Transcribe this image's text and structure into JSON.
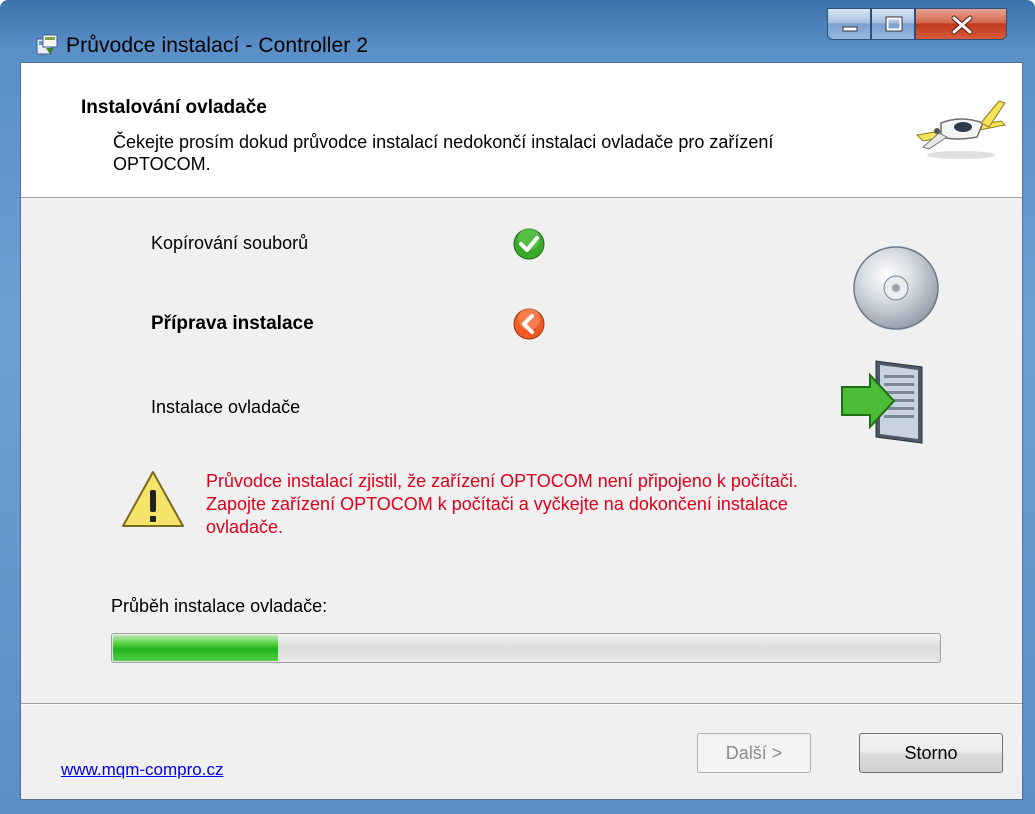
{
  "window": {
    "title": "Průvodce instalací - Controller 2",
    "accent_color": "#5b8ec5"
  },
  "header": {
    "title": "Instalování ovladače",
    "subtitle": "Čekejte prosím dokud průvodce instalací nedokončí instalaci ovladače pro zařízení OPTOCOM.",
    "logo_icon": "airplane-icon"
  },
  "steps": [
    {
      "label": "Kopírování souborů",
      "status": "done",
      "status_icon": "green-check-icon",
      "side_icon": "cd-icon"
    },
    {
      "label": "Příprava instalace",
      "status": "current",
      "status_icon": "orange-arrow-left-icon",
      "side_icon": "server-install-icon"
    },
    {
      "label": "Instalace ovladače",
      "status": "pending",
      "status_icon": "",
      "side_icon": ""
    }
  ],
  "warning": {
    "icon": "warning-triangle-icon",
    "text": "Průvodce instalací zjistil, že zařízení OPTOCOM není připojeno k počítači. Zapojte zařízení OPTOCOM k počítači a vyčkejte na dokončení instalace ovladače.",
    "color": "#e0001c"
  },
  "progress": {
    "label": "Průběh instalace ovladače:",
    "value_fraction": 0.2
  },
  "footer": {
    "link": "www.mqm-compro.cz",
    "next_label": "Další >",
    "next_enabled": false,
    "cancel_label": "Storno"
  }
}
